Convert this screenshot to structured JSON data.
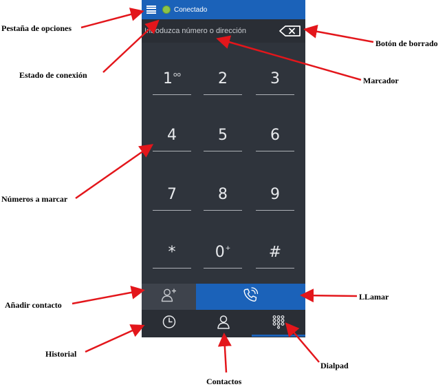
{
  "status_bar": {
    "connection_text": "Conectado"
  },
  "dialer": {
    "placeholder": "Introduzca número o dirección"
  },
  "keypad": {
    "keys": [
      {
        "main": "1",
        "sup": "oo"
      },
      {
        "main": "2",
        "sup": ""
      },
      {
        "main": "3",
        "sup": ""
      },
      {
        "main": "4",
        "sup": ""
      },
      {
        "main": "5",
        "sup": ""
      },
      {
        "main": "6",
        "sup": ""
      },
      {
        "main": "7",
        "sup": ""
      },
      {
        "main": "8",
        "sup": ""
      },
      {
        "main": "9",
        "sup": ""
      },
      {
        "main": "*",
        "sup": ""
      },
      {
        "main": "0",
        "sup": "+"
      },
      {
        "main": "#",
        "sup": ""
      }
    ]
  },
  "icons": {
    "menu": "menu-icon",
    "backspace": "backspace-icon",
    "add_contact": "add-contact-icon",
    "call": "phone-call-icon",
    "history": "clock-icon",
    "contacts": "person-icon",
    "dialpad": "dialpad-icon"
  },
  "colors": {
    "primary_blue": "#1b62b9",
    "panel_dark": "#2f343c",
    "connected_green": "#8bc34a",
    "annotation_arrow": "#e3161b"
  },
  "annotations": {
    "options_tab": "Pestaña de opciones",
    "connection_status": "Estado de conexión",
    "delete_button": "Botón de borrado",
    "dialer": "Marcador",
    "numbers": "Números a marcar",
    "add_contact": "Añadir contacto",
    "call": "LLamar",
    "history": "Historial",
    "dialpad": "Dialpad",
    "contacts": "Contactos"
  }
}
